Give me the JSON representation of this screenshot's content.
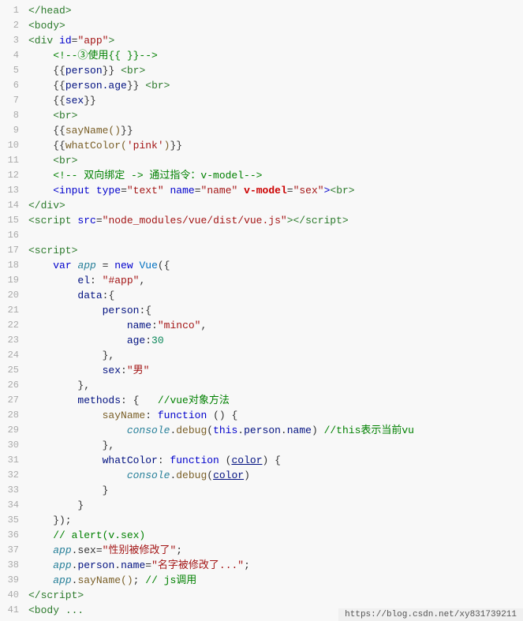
{
  "lines": [
    {
      "num": "",
      "html": "<span class='c-tag'>&lt;/head&gt;</span>"
    },
    {
      "num": "",
      "html": "<span class='c-tag'>&lt;body&gt;</span>"
    },
    {
      "num": "",
      "html": "<span class='c-tag'>&lt;div</span> <span class='c-attr'>id</span>=<span class='c-value'>\"app\"</span><span class='c-tag'>&gt;</span>"
    },
    {
      "num": "",
      "html": "    <span class='c-comment'>&lt;!--③使用{{ }}--&gt;</span>"
    },
    {
      "num": "",
      "html": "    <span class='c-bracket'>{{</span><span class='c-prop'>person</span><span class='c-bracket'>}}</span> <span class='c-tag'>&lt;br&gt;</span>"
    },
    {
      "num": "",
      "html": "    <span class='c-bracket'>{{</span><span class='c-prop'>person.age</span><span class='c-bracket'>}}</span> <span class='c-tag'>&lt;br&gt;</span>"
    },
    {
      "num": "",
      "html": "    <span class='c-bracket'>{{</span><span class='c-prop'>sex</span><span class='c-bracket'>}}</span>"
    },
    {
      "num": "",
      "html": "    <span class='c-tag'>&lt;br&gt;</span>"
    },
    {
      "num": "",
      "html": "    <span class='c-bracket'>{{</span><span class='c-method'>sayName()</span><span class='c-bracket'>}}</span>"
    },
    {
      "num": "",
      "html": "    <span class='c-bracket'>{{</span><span class='c-method'>whatColor(<span class='c-string'>'pink'</span>)</span><span class='c-bracket'>}}</span>"
    },
    {
      "num": "",
      "html": "    <span class='c-tag'>&lt;br&gt;</span>"
    },
    {
      "num": "",
      "html": "    <span class='c-comment'>&lt;!-- 双向绑定 -&gt; 通过指令：v-model--&gt;</span>"
    },
    {
      "num": "",
      "html": "    <span class='c-input'>&lt;input</span> <span class='c-attr'>type</span>=<span class='c-value'>\"text\"</span> <span class='c-attr'>name</span>=<span class='c-value'>\"name\"</span> <span class='c-directive'>v-model</span>=<span class='c-value'>\"sex\"</span><span class='c-input'>&gt;</span><span class='c-tag'>&lt;br&gt;</span>"
    },
    {
      "num": "",
      "html": "<span class='c-tag'>&lt;/div&gt;</span>"
    },
    {
      "num": "",
      "html": "<span class='c-tag'>&lt;script</span> <span class='c-attr'>src</span>=<span class='c-value'>\"node_modules/vue/dist/vue.js\"</span><span class='c-tag'>&gt;&lt;/script&gt;</span>"
    },
    {
      "num": "",
      "html": ""
    },
    {
      "num": "",
      "html": "<span class='c-tag'>&lt;script&gt;</span>"
    },
    {
      "num": "",
      "html": "    <span class='c-keyword'>var</span> <span class='c-app c-italic'>app</span> = <span class='c-keyword'>new</span> <span class='c-blue'>Vue</span>({"
    },
    {
      "num": "",
      "html": "        <span class='c-prop'>el</span>: <span class='c-string'>\"#app\"</span>,"
    },
    {
      "num": "",
      "html": "        <span class='c-prop'>data</span>:{"
    },
    {
      "num": "",
      "html": "            <span class='c-prop'>person</span>:{"
    },
    {
      "num": "",
      "html": "                <span class='c-prop'>name</span>:<span class='c-string'>\"minco\"</span>,"
    },
    {
      "num": "",
      "html": "                <span class='c-prop'>age</span>:<span class='c-num'>30</span>"
    },
    {
      "num": "",
      "html": "            },"
    },
    {
      "num": "",
      "html": "            <span class='c-prop'>sex</span>:<span class='c-string'>\"男\"</span>"
    },
    {
      "num": "",
      "html": "        },"
    },
    {
      "num": "",
      "html": "        <span class='c-prop'>methods</span>: {   <span class='c-comment'>//vue对象方法</span>"
    },
    {
      "num": "",
      "html": "            <span class='c-method'>sayName</span>: <span class='c-keyword'>function</span> () {"
    },
    {
      "num": "",
      "html": "                <span class='c-console c-italic'>console</span>.<span class='c-method'>debug</span>(<span class='c-this c-keyword'>this</span>.<span class='c-prop'>person</span>.<span class='c-prop'>name</span>) <span class='c-comment'>//this表示当前vu</span>"
    },
    {
      "num": "",
      "html": "            },"
    },
    {
      "num": "",
      "html": "            <span class='c-prop'>whatColor</span>: <span class='c-keyword'>function</span> (<span class='c-underline c-prop'>color</span>) {"
    },
    {
      "num": "",
      "html": "                <span class='c-console c-italic'>console</span>.<span class='c-method'>debug</span>(<span class='c-underline c-prop'>color</span>)"
    },
    {
      "num": "",
      "html": "            }"
    },
    {
      "num": "",
      "html": "        }"
    },
    {
      "num": "",
      "html": "    });"
    },
    {
      "num": "",
      "html": "    <span class='c-comment'>// alert(v.sex)</span>"
    },
    {
      "num": "",
      "html": "    <span class='c-app c-italic'>app</span>.sex=<span class='c-string'>\"性别被修改了\"</span>;<span class='c-cursor'></span>"
    },
    {
      "num": "",
      "html": "    <span class='c-app c-italic'>app</span>.<span class='c-prop'>person</span>.<span class='c-prop'>name</span>=<span class='c-string'>\"名字被修改了...\"</span>;"
    },
    {
      "num": "",
      "html": "    <span class='c-app c-italic'>app</span>.<span class='c-method'>sayName()</span>; <span class='c-comment'>// js调用</span>"
    },
    {
      "num": "",
      "html": "<span class='c-tag'>&lt;/script&gt;</span>"
    },
    {
      "num": "",
      "html": "<span class='c-tag'>&lt;body</span> <span class='c-tag'>...</span>"
    }
  ],
  "bottom_bar": {
    "url": "https://blog.csdn.net/xy831739211"
  }
}
